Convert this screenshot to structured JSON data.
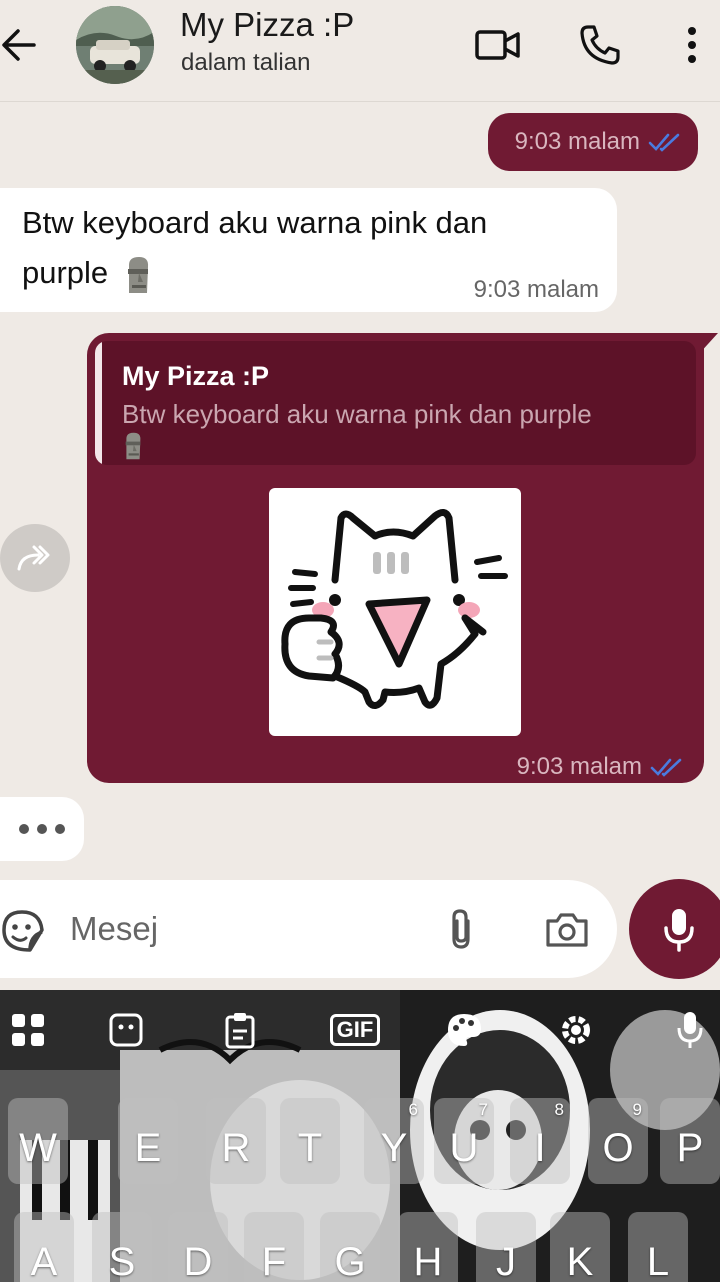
{
  "header": {
    "contact_name": "My Pizza :P",
    "contact_status": "dalam talian"
  },
  "messages": [
    {
      "direction": "out",
      "time": "9:03 malam",
      "status": "read"
    },
    {
      "direction": "in",
      "text": "Btw keyboard aku warna pink dan purple",
      "emoji": "moai",
      "time": "9:03 malam"
    },
    {
      "direction": "out",
      "reply": {
        "name": "My Pizza :P",
        "text": "Btw keyboard aku warna pink dan purple",
        "emoji": "moai"
      },
      "sticker": "cat-thumbs-up-sticker",
      "time": "9:03 malam",
      "status": "read"
    }
  ],
  "composer": {
    "placeholder": "Mesej"
  },
  "keyboard": {
    "row1": [
      {
        "ch": "W",
        "num": ""
      },
      {
        "ch": "E",
        "num": ""
      },
      {
        "ch": "R",
        "num": ""
      },
      {
        "ch": "T",
        "num": ""
      },
      {
        "ch": "Y",
        "num": "6"
      },
      {
        "ch": "U",
        "num": "7"
      },
      {
        "ch": "I",
        "num": "8"
      },
      {
        "ch": "O",
        "num": "9"
      },
      {
        "ch": "P",
        "num": ""
      }
    ],
    "row2": [
      {
        "ch": "A"
      },
      {
        "ch": "S"
      },
      {
        "ch": "D"
      },
      {
        "ch": "F"
      },
      {
        "ch": "G"
      },
      {
        "ch": "H"
      },
      {
        "ch": "J"
      },
      {
        "ch": "K"
      },
      {
        "ch": "L"
      }
    ],
    "toolbar": [
      "apps-icon",
      "sticker-icon",
      "clipboard-icon",
      "gif-icon",
      "palette-icon",
      "settings-icon",
      "voice-icon"
    ],
    "gif_label": "GIF"
  },
  "colors": {
    "accent": "#701a33",
    "background": "#efeae5",
    "read_ticks": "#4a7be0"
  }
}
